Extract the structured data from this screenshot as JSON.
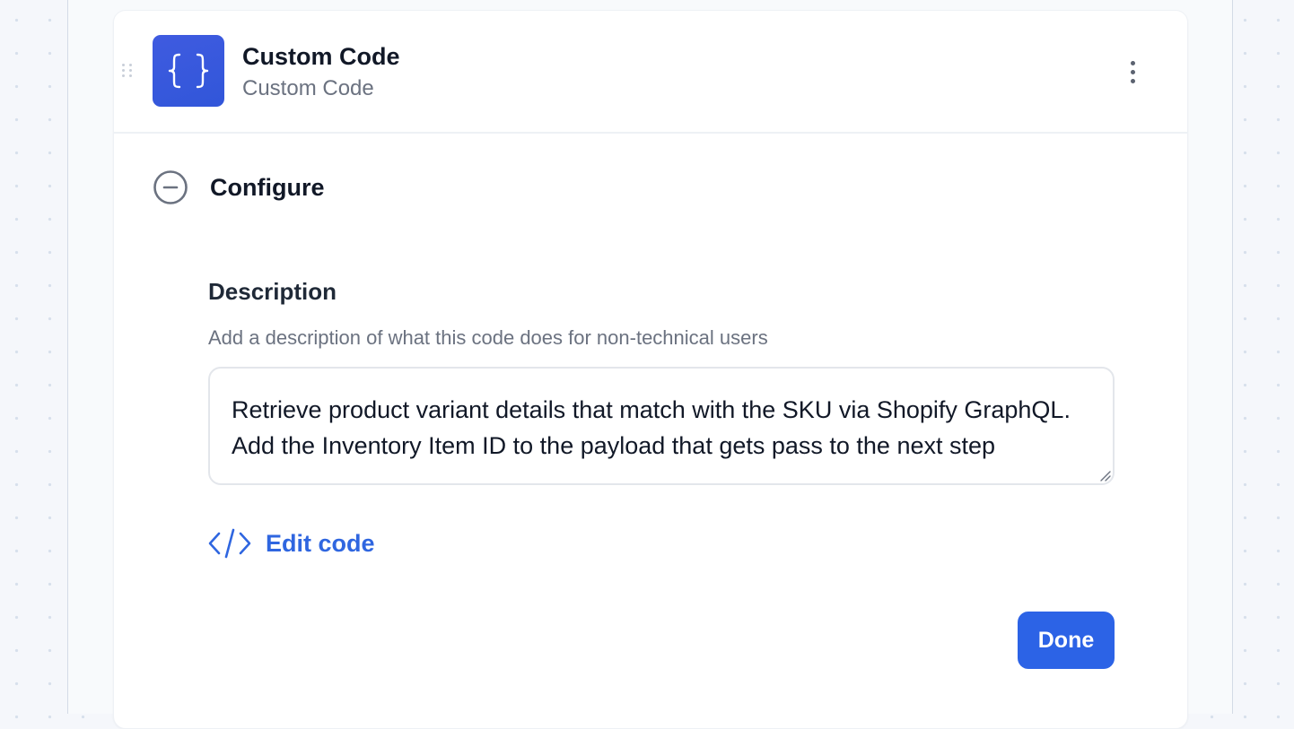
{
  "step": {
    "title": "Custom Code",
    "subtitle": "Custom Code",
    "icon": "curly-braces-icon",
    "accent_color": "#3156d9"
  },
  "configure": {
    "title": "Configure"
  },
  "description_field": {
    "label": "Description",
    "help_text": "Add a description of what this code does for non-technical users",
    "value": "Retrieve product variant details that match with the SKU via Shopify GraphQL. Add the Inventory Item ID to the payload that gets pass to the next step"
  },
  "edit_code": {
    "label": "Edit code",
    "icon": "code-icon",
    "color": "#2f66e0"
  },
  "done": {
    "label": "Done",
    "color": "#2c63e6"
  }
}
